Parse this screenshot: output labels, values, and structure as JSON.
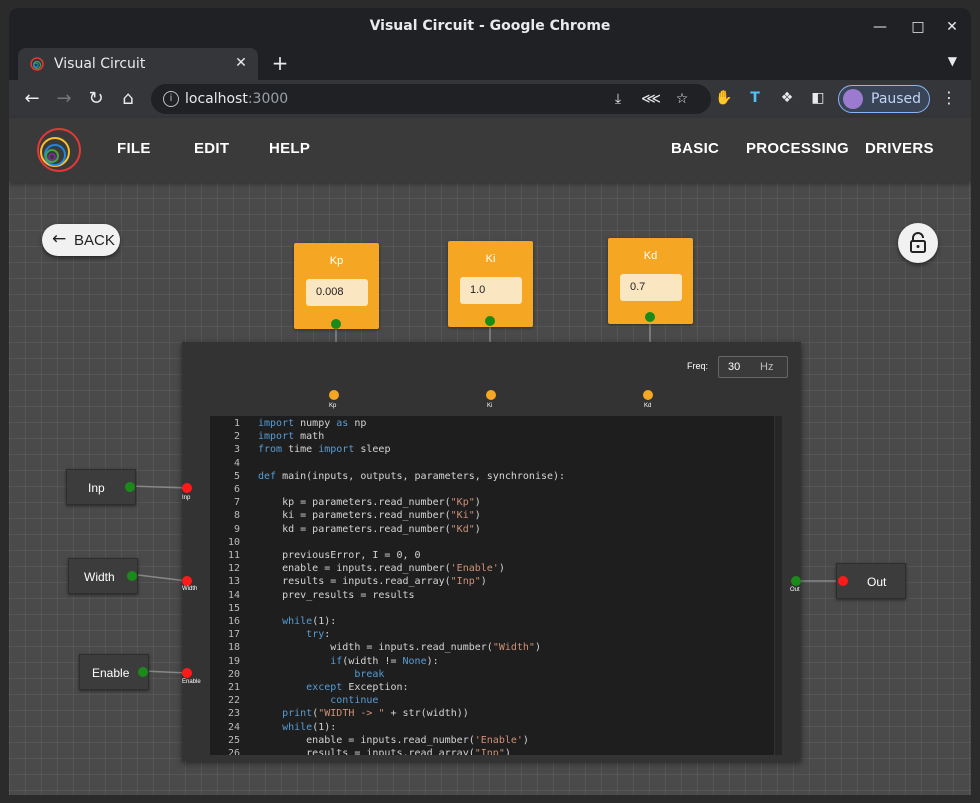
{
  "browser": {
    "window_title": "Visual Circuit - Google Chrome",
    "tab_title": "Visual Circuit",
    "url_host": "localhost",
    "url_port": ":3000",
    "profile_label": "Paused"
  },
  "app": {
    "menu": {
      "file": "FILE",
      "edit": "EDIT",
      "help": "HELP",
      "basic": "BASIC",
      "processing": "PROCESSING",
      "drivers": "DRIVERS"
    },
    "back_label": "BACK",
    "params": [
      {
        "name": "Kp",
        "value": "0.008"
      },
      {
        "name": "Ki",
        "value": "1.0"
      },
      {
        "name": "Kd",
        "value": "0.7"
      }
    ],
    "code_block": {
      "freq_label": "Freq:",
      "freq_value": "30",
      "freq_unit": "Hz",
      "param_ports": [
        "Kp",
        "Ki",
        "Kd"
      ],
      "input_ports": [
        "Inp",
        "Width",
        "Enable"
      ],
      "output_ports": [
        "Out"
      ]
    },
    "inputs": [
      "Inp",
      "Width",
      "Enable"
    ],
    "outputs": [
      "Out"
    ],
    "code_lines": [
      "import numpy as np",
      "import math",
      "from time import sleep",
      "",
      "def main(inputs, outputs, parameters, synchronise):",
      "",
      "    kp = parameters.read_number(\"Kp\")",
      "    ki = parameters.read_number(\"Ki\")",
      "    kd = parameters.read_number(\"Kd\")",
      "",
      "    previousError, I = 0, 0",
      "    enable = inputs.read_number('Enable')",
      "    results = inputs.read_array(\"Inp\")",
      "    prev_results = results",
      "",
      "    while(1):",
      "        try:",
      "            width = inputs.read_number(\"Width\")",
      "            if(width != None):",
      "                break",
      "        except Exception:",
      "            continue",
      "    print(\"WIDTH -> \" + str(width))",
      "    while(1):",
      "        enable = inputs.read_number('Enable')",
      "        results = inputs.read_array(\"Inp\")"
    ]
  },
  "colors": {
    "param_block": "#f5a623",
    "port_connected": "#1a8a1a",
    "port_input": "#ff1a1a",
    "keyword": "#569cd6",
    "string": "#ce9178"
  }
}
